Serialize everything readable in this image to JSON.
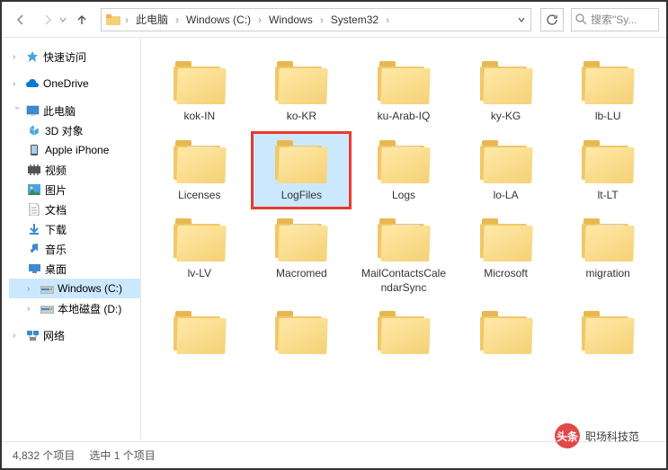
{
  "breadcrumb": {
    "parts": [
      "此电脑",
      "Windows (C:)",
      "Windows",
      "System32"
    ]
  },
  "search": {
    "placeholder": "搜索\"Sy..."
  },
  "tree": {
    "quick_access": "快速访问",
    "onedrive": "OneDrive",
    "this_pc": "此电脑",
    "children": {
      "objects3d": "3D 对象",
      "iphone": "Apple iPhone",
      "videos": "视频",
      "pictures": "图片",
      "documents": "文档",
      "downloads": "下载",
      "music": "音乐",
      "desktop": "桌面",
      "c_drive": "Windows (C:)",
      "d_drive": "本地磁盘 (D:)"
    },
    "network": "网络"
  },
  "folders": [
    {
      "name": "kok-IN",
      "doc": false
    },
    {
      "name": "ko-KR",
      "doc": false
    },
    {
      "name": "ku-Arab-IQ",
      "doc": false
    },
    {
      "name": "ky-KG",
      "doc": false
    },
    {
      "name": "lb-LU",
      "doc": false
    },
    {
      "name": "Licenses",
      "doc": true,
      "sel": false
    },
    {
      "name": "LogFiles",
      "doc": true,
      "sel": true,
      "hi": true
    },
    {
      "name": "Logs",
      "doc": true
    },
    {
      "name": "lo-LA",
      "doc": false
    },
    {
      "name": "lt-LT",
      "doc": false
    },
    {
      "name": "lv-LV",
      "doc": false
    },
    {
      "name": "Macromed",
      "doc": true
    },
    {
      "name": "MailContactsCalendarSync",
      "doc": true
    },
    {
      "name": "Microsoft",
      "doc": false
    },
    {
      "name": "migration",
      "doc": true
    },
    {
      "name": "",
      "doc": false
    },
    {
      "name": "",
      "doc": false
    },
    {
      "name": "",
      "doc": false
    },
    {
      "name": "",
      "doc": false
    },
    {
      "name": "",
      "doc": false
    }
  ],
  "status": {
    "count": "4,832 个项目",
    "selected": "选中 1 个项目"
  },
  "watermark": {
    "prefix": "头条",
    "text": "职场科技范"
  }
}
